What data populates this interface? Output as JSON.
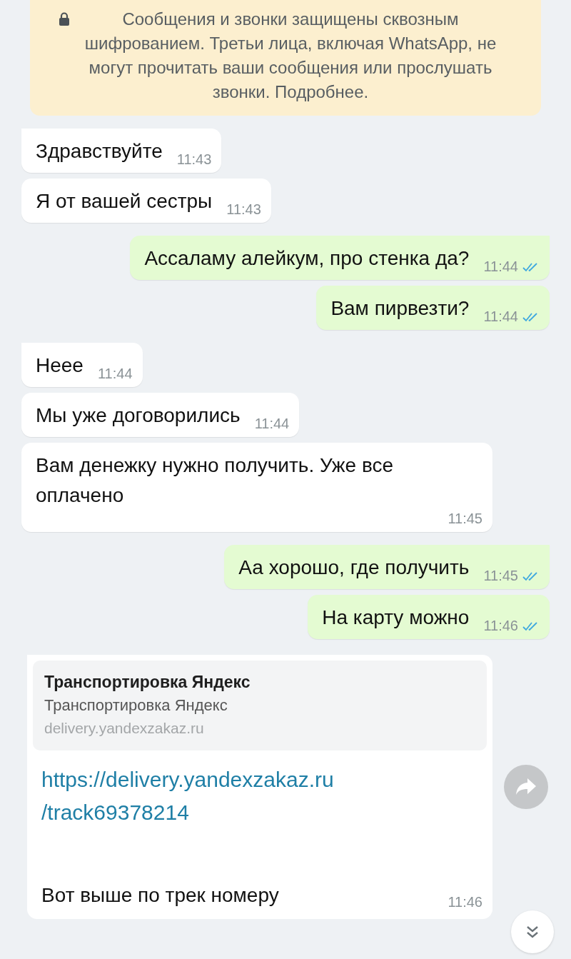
{
  "encryption_notice": "Сообщения и звонки защищены сквозным шифрованием. Третьи лица, включая WhatsApp, не могут прочитать ваши сообщения или прослушать звонки. Подробнее.",
  "messages": [
    {
      "kind": "incoming",
      "text": "Здравствуйте",
      "time": "11:43",
      "tail": true
    },
    {
      "kind": "incoming",
      "text": "Я от вашей сестры",
      "time": "11:43",
      "tail": false
    },
    {
      "kind": "outgoing",
      "text": "Ассаламу алейкум, про стенка да?",
      "time": "11:44",
      "tail": true,
      "read": true
    },
    {
      "kind": "outgoing",
      "text": "Вам пирвезти?",
      "time": "11:44",
      "tail": false,
      "read": true
    },
    {
      "kind": "incoming",
      "text": "Неее",
      "time": "11:44",
      "tail": true
    },
    {
      "kind": "incoming",
      "text": "Мы уже договорились",
      "time": "11:44",
      "tail": false
    },
    {
      "kind": "incoming",
      "text": "Вам денежку нужно получить. Уже все оплачено",
      "time": "11:45",
      "tail": false
    },
    {
      "kind": "outgoing",
      "text": "Аа хорошо, где получить",
      "time": "11:45",
      "tail": true,
      "read": true
    },
    {
      "kind": "outgoing",
      "text": "На карту можно",
      "time": "11:46",
      "tail": false,
      "read": true
    },
    {
      "kind": "link",
      "tail": true,
      "preview": {
        "title": "Транспортировка Яндекс",
        "subtitle": "Транспортировка Яндекс",
        "domain": "delivery.yandexzakaz.ru"
      },
      "link": "https://delivery.yandexzakaz.ru/track69378214",
      "text": "Вот выше по трек номеру",
      "time": "11:46"
    }
  ]
}
